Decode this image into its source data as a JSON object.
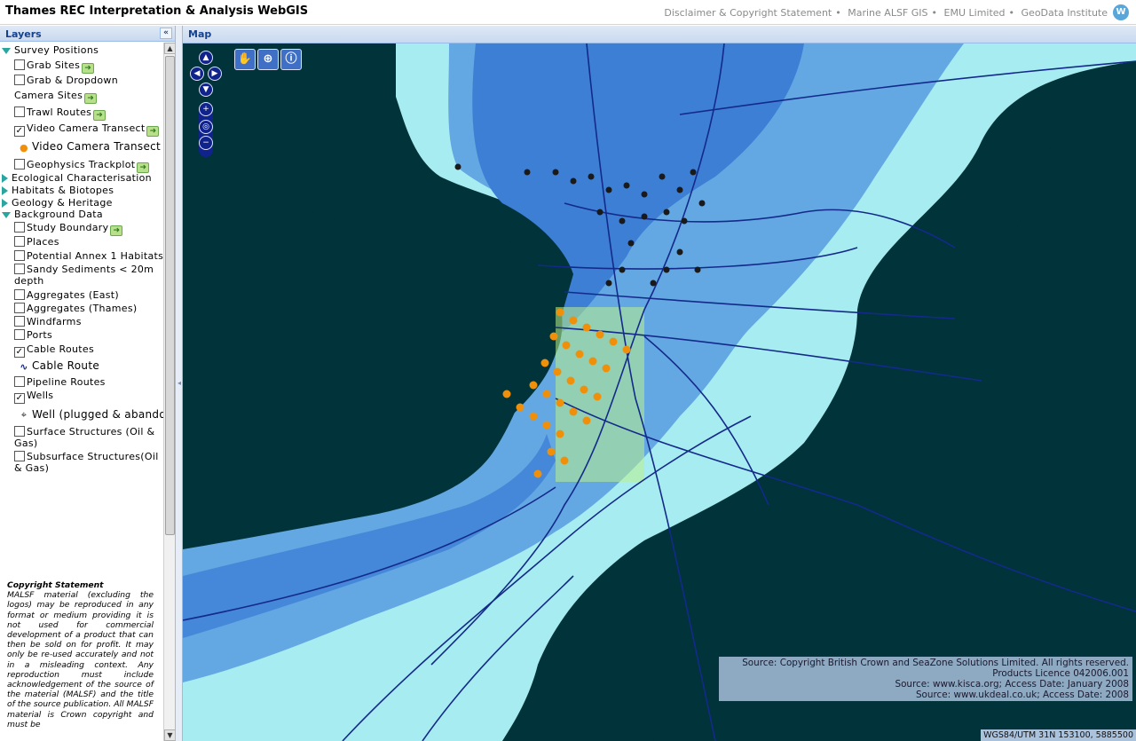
{
  "header": {
    "title": "Thames REC Interpretation & Analysis WebGIS",
    "links": [
      "Disclaimer & Copyright Statement",
      "Marine ALSF GIS",
      "EMU Limited",
      "GeoData Institute"
    ],
    "separator": "•",
    "logo_glyph": "W"
  },
  "layers_panel": {
    "title": "Layers",
    "collapse_glyph": "«",
    "groups": {
      "survey": "Survey Positions",
      "grab_sites": "Grab Sites",
      "grab_dropdown": "Grab & Dropdown",
      "camera_sites": "Camera Sites",
      "trawl_routes": "Trawl Routes",
      "video_transect": "Video Camera Transect",
      "video_transect_legend": "Video Camera Transect",
      "geophysics": "Geophysics Trackplot",
      "ecological": "Ecological Characterisation",
      "habitats": "Habitats & Biotopes",
      "geology": "Geology & Heritage",
      "background": "Background Data",
      "study_boundary": "Study Boundary",
      "places": "Places",
      "annex1": "Potential Annex 1 Habitats",
      "sandy_1": "Sandy Sediments < 20m",
      "sandy_2": "depth",
      "agg_east": "Aggregates (East)",
      "agg_thames": "Aggregates (Thames)",
      "windfarms": "Windfarms",
      "ports": "Ports",
      "cable_routes": "Cable Routes",
      "cable_route_legend": "Cable Route",
      "pipeline_routes": "Pipeline Routes",
      "wells": "Wells",
      "wells_legend": "Well (plugged & abando",
      "surface_1": "Surface Structures (Oil &",
      "surface_2": "Gas)",
      "subsurface_1": "Subsurface Structures(Oil",
      "subsurface_2": "& Gas)"
    },
    "checked": {
      "video_transect": true,
      "cable_routes": true,
      "wells": true
    },
    "copyright": {
      "title": "Copyright Statement",
      "body": "MALSF material (excluding the logos) may be reproduced in any format or medium providing it is not used for commercial development of a product that can then be sold on for profit. It may only be re-used accurately and not in a misleading context. Any reproduction must include acknowledgement of the source of the material (MALSF) and the title of the source publication. All MALSF material is Crown copyright and must be"
    }
  },
  "map_panel": {
    "title": "Map",
    "attribution": [
      "Source: Copyright British Crown and SeaZone Solutions Limited. All rights reserved.",
      "Products Licence 042006.001",
      "Source: www.kisca.org; Access Date: January 2008",
      "Source: www.ukdeal.co.uk; Access Date: 2008"
    ],
    "coordinates": "WGS84/UTM 31N   153100, 5885500",
    "colors": {
      "land": "#00333a",
      "deep_sea": "#3d7fd4",
      "mid_sea": "#63a7e3",
      "shallow_sea": "#a7ecf0",
      "cable": "#142a8a",
      "transect": "#f0900a",
      "well": "#1a1a1a"
    }
  }
}
